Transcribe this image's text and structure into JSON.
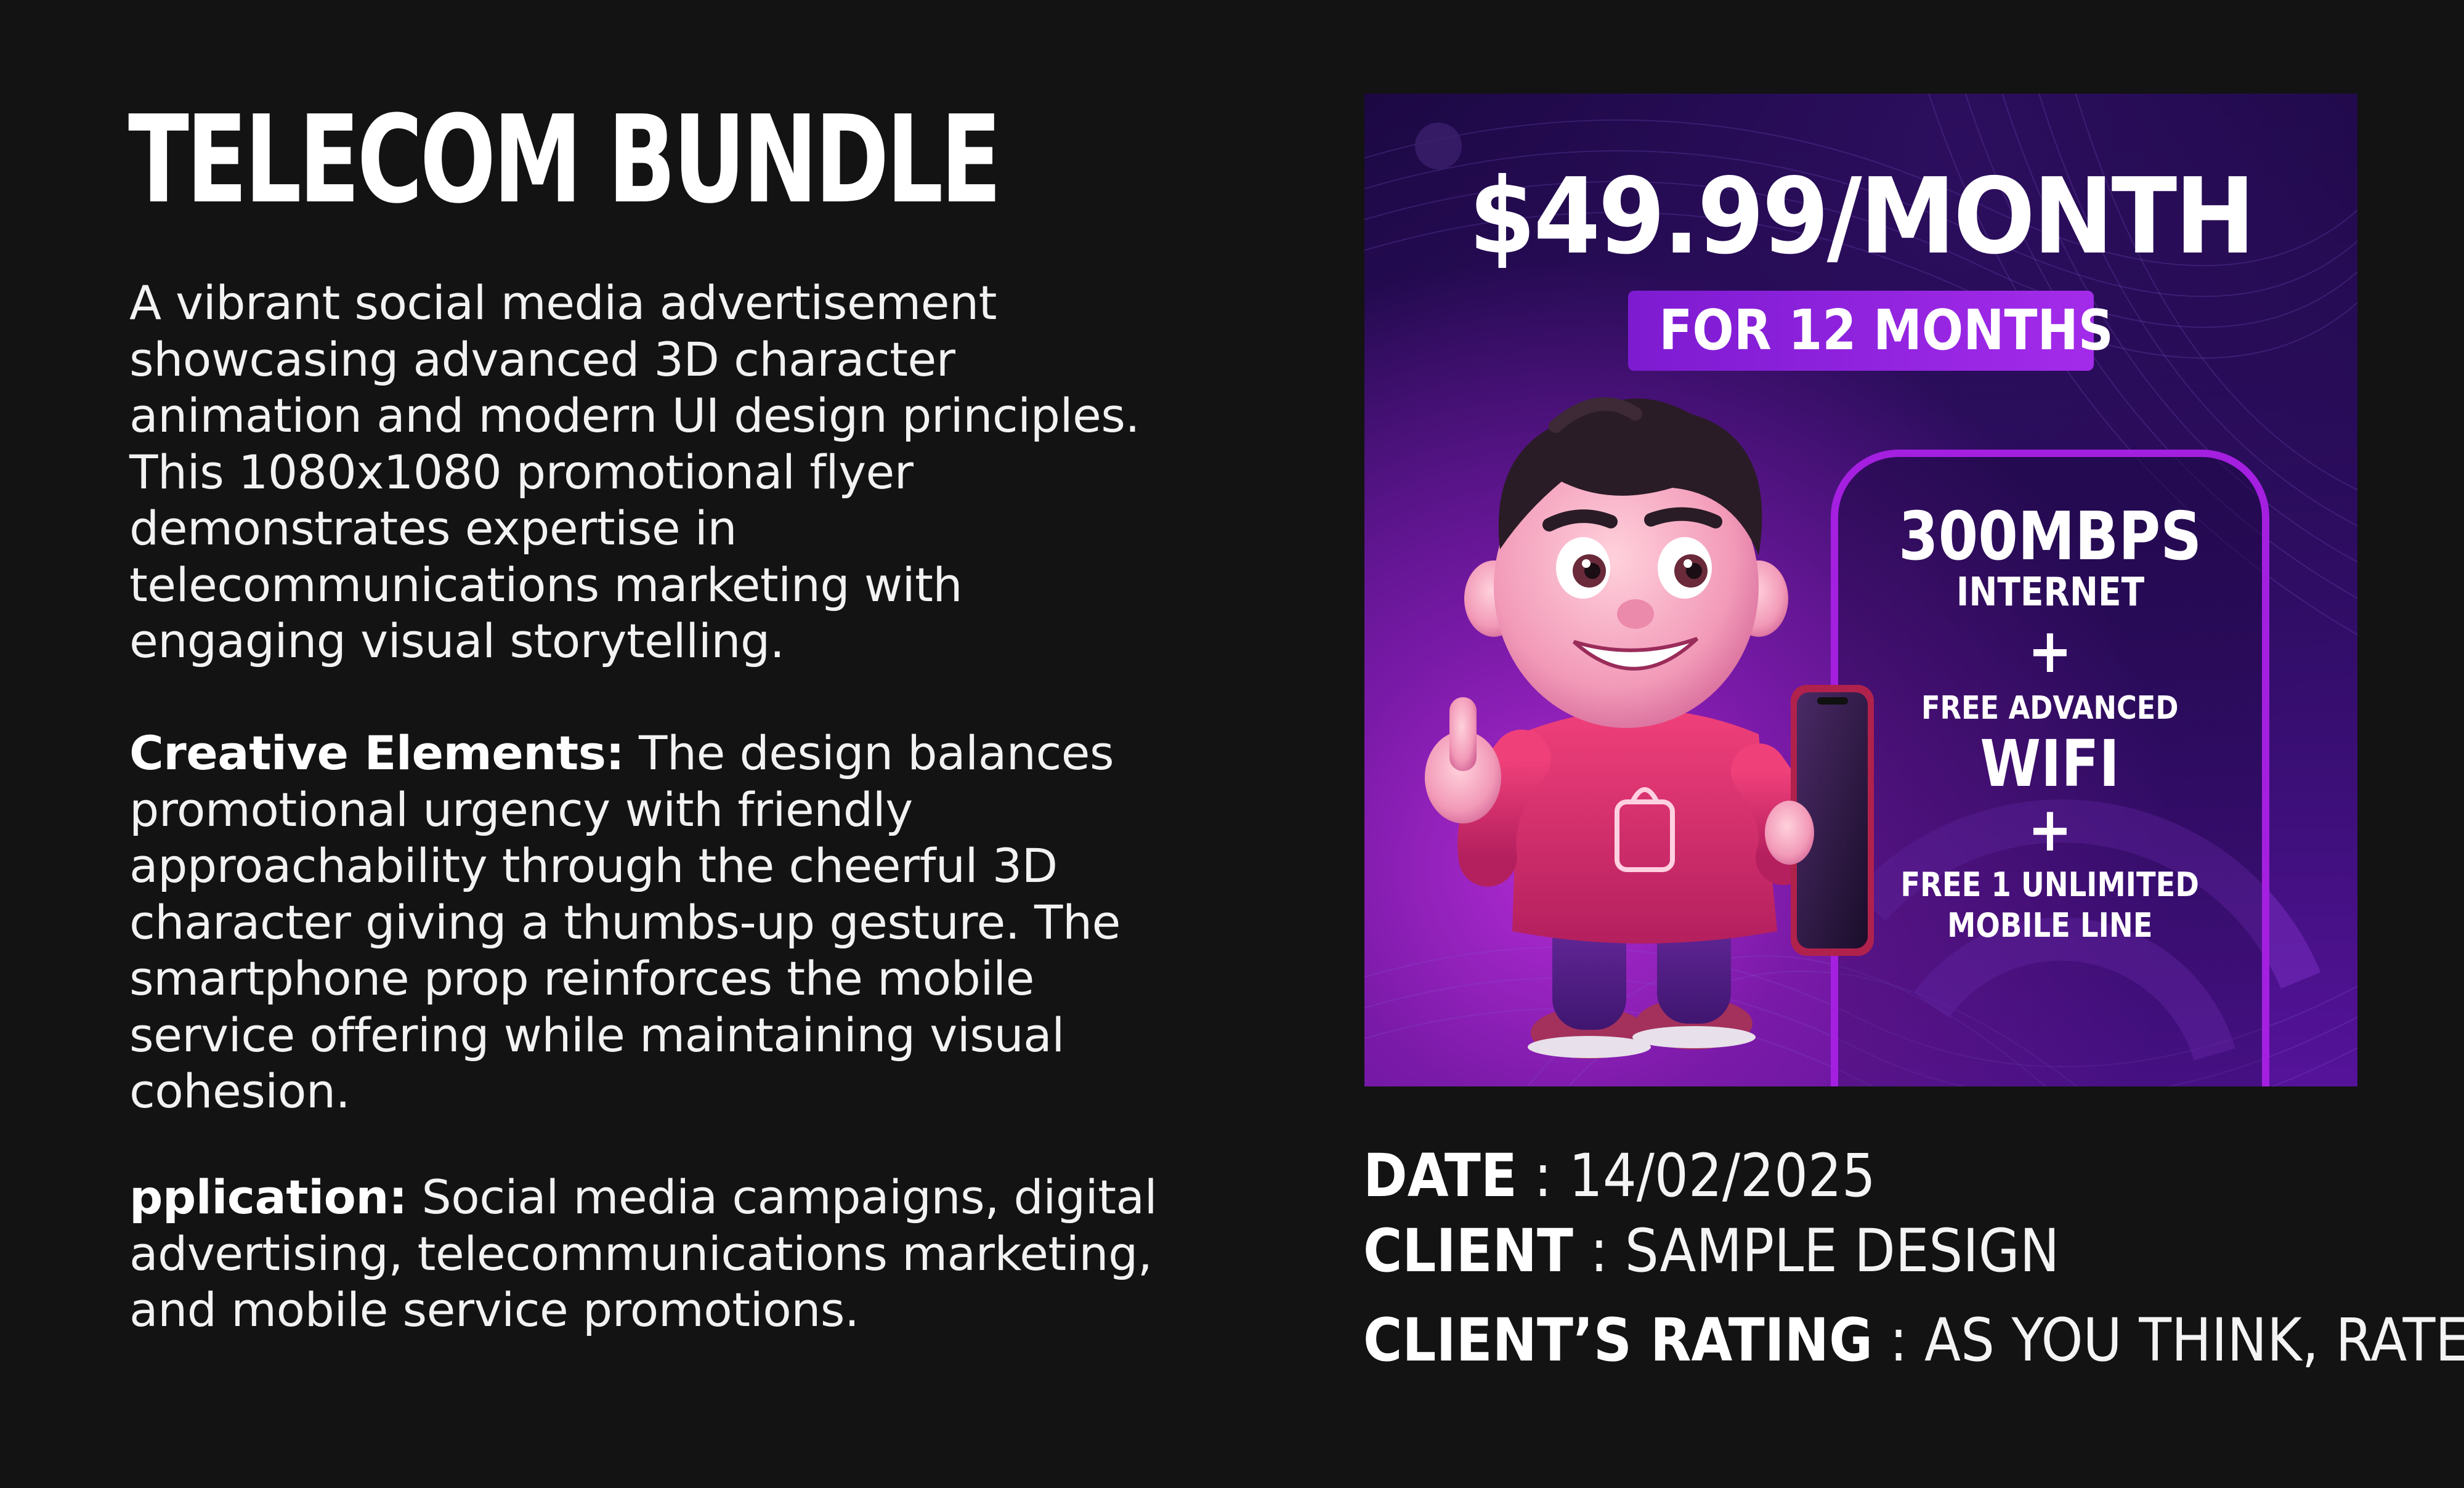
{
  "page": {
    "title": "TELECOM BUNDLE",
    "background": "#131313"
  },
  "description": {
    "intro": "A vibrant social media advertisement showcasing advanced 3D character animation and modern UI design principles. This 1080x1080 promotional flyer demonstrates expertise in telecommunications marketing with engaging visual storytelling.",
    "creative_label": "Creative Elements:",
    "creative_text": " The design balances promotional urgency with friendly approachability through the cheerful 3D character giving a thumbs-up gesture. The smartphone prop reinforces the mobile service offering while maintaining visual cohesion.",
    "application_label": "pplication:",
    "application_text": " Social media campaigns, digital advertising, telecommunications marketing, and mobile service promotions."
  },
  "flyer": {
    "price": "$49.99/MONTH",
    "duration": "FOR 12 MONTHS",
    "speed": "300MBPS",
    "internet": "INTERNET",
    "plus": "+",
    "free_advanced": "FREE ADVANCED",
    "wifi": "WIFI",
    "free_line": "FREE 1 UNLIMITED",
    "mobile_line": "MOBILE LINE",
    "accent_color": "#a41fe0",
    "character_icon": "3d-boy-thumbs-up-with-phone"
  },
  "meta": {
    "date_label": "DATE",
    "date_value": "14/02/2025",
    "client_label": "CLIENT",
    "client_value": "SAMPLE DESIGN",
    "rating_label": "CLIENT’S RATING",
    "rating_value": "AS YOU THINK, RATE.",
    "separator": " : "
  }
}
